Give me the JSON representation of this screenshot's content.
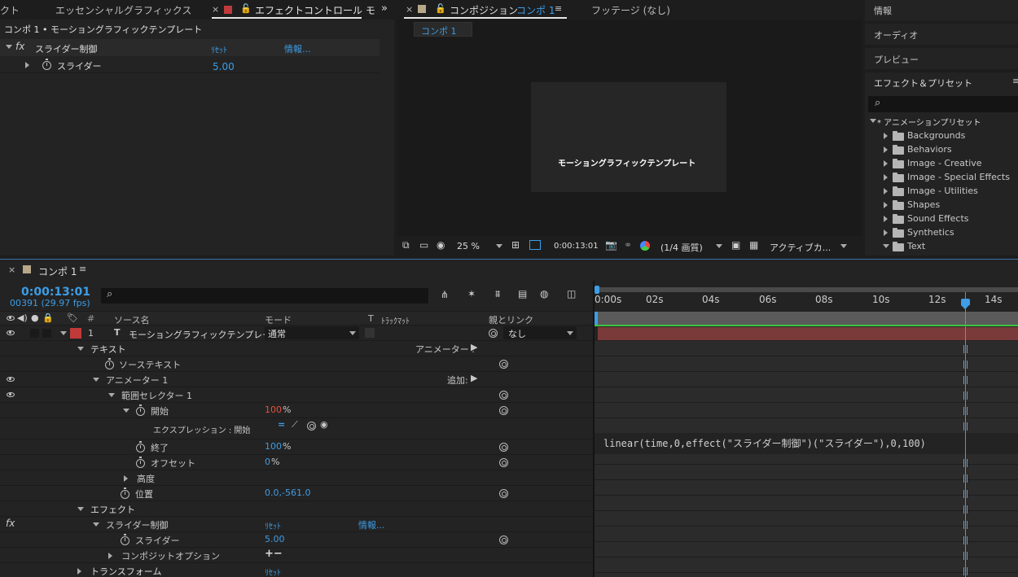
{
  "effect_panel": {
    "tabs": [
      "クト",
      "エッセンシャルグラフィックス",
      "エフェクトコントロール モ"
    ],
    "header": "コンポ 1 • モーショングラフィックテンプレート",
    "effect_name": "スライダー制御",
    "reset_label": "ﾘｾｯﾄ",
    "info_label": "情報...",
    "slider_label": "スライダー",
    "slider_value": "5.00"
  },
  "comp_panel": {
    "tab_label": "コンポジション",
    "tab_comp": "コンポ 1",
    "footage_tab": "フッテージ (なし)",
    "subtab": "コンポ 1",
    "canvas_text": "モーショングラフィックテンプレート",
    "zoom": "25 %",
    "timecode": "0:00:13:01",
    "resolution": "(1/4 画質)",
    "camera": "アクティブカ..."
  },
  "right_panel": {
    "items": [
      "情報",
      "オーディオ",
      "プレビュー"
    ],
    "effects_title": "エフェクト＆プリセット",
    "search_icon": "⌕",
    "tree_root": "* アニメーションプリセット",
    "folders": [
      "Backgrounds",
      "Behaviors",
      "Image - Creative",
      "Image - Special Effects",
      "Image - Utilities",
      "Shapes",
      "Sound Effects",
      "Synthetics",
      "Text"
    ]
  },
  "timeline": {
    "tab_label": "コンポ 1",
    "timecode": "0:00:13:01",
    "frames": "00391 (29.97 fps)",
    "col_source": "ソース名",
    "col_mode": "モード",
    "col_t": "T",
    "col_track": "ﾄﾗｯｸﾏｯﾄ",
    "col_parent": "親とリンク",
    "ruler": [
      "0:00s",
      "02s",
      "04s",
      "06s",
      "08s",
      "10s",
      "12s",
      "14s"
    ],
    "layer_index": "1",
    "layer_type": "T",
    "layer_name": "モーショングラフィックテンプレート",
    "layer_mode": "通常",
    "layer_parent": "なし",
    "rows": {
      "text": "テキスト",
      "animator_menu": "アニメーター :",
      "source_text": "ソーステキスト",
      "animator1": "アニメーター 1",
      "add": "追加:",
      "range_selector": "範囲セレクター 1",
      "start": "開始",
      "start_value": "100",
      "start_unit": "%",
      "expression_label": "エクスプレッション : 開始",
      "expression": "linear(time,0,effect(\"スライダー制御\")(\"スライダー\"),0,100)",
      "end": "終了",
      "end_value": "100",
      "end_unit": "%",
      "offset": "オフセット",
      "offset_value": "0",
      "offset_unit": "%",
      "advanced": "高度",
      "position": "位置",
      "position_value": "0.0,-561.0",
      "effects": "エフェクト",
      "slider_control": "スライダー制御",
      "reset": "ﾘｾｯﾄ",
      "info": "情報...",
      "slider": "スライダー",
      "slider_value": "5.00",
      "composite": "コンポジットオプション",
      "composite_ops": "+−",
      "transform": "トランスフォーム",
      "transform_reset": "ﾘｾｯﾄ"
    }
  },
  "colors": {
    "accent": "#3d9de6",
    "layer_bar": "#7b3a3a",
    "green_line": "#3fc53f",
    "label_red": "#c03a3a"
  }
}
